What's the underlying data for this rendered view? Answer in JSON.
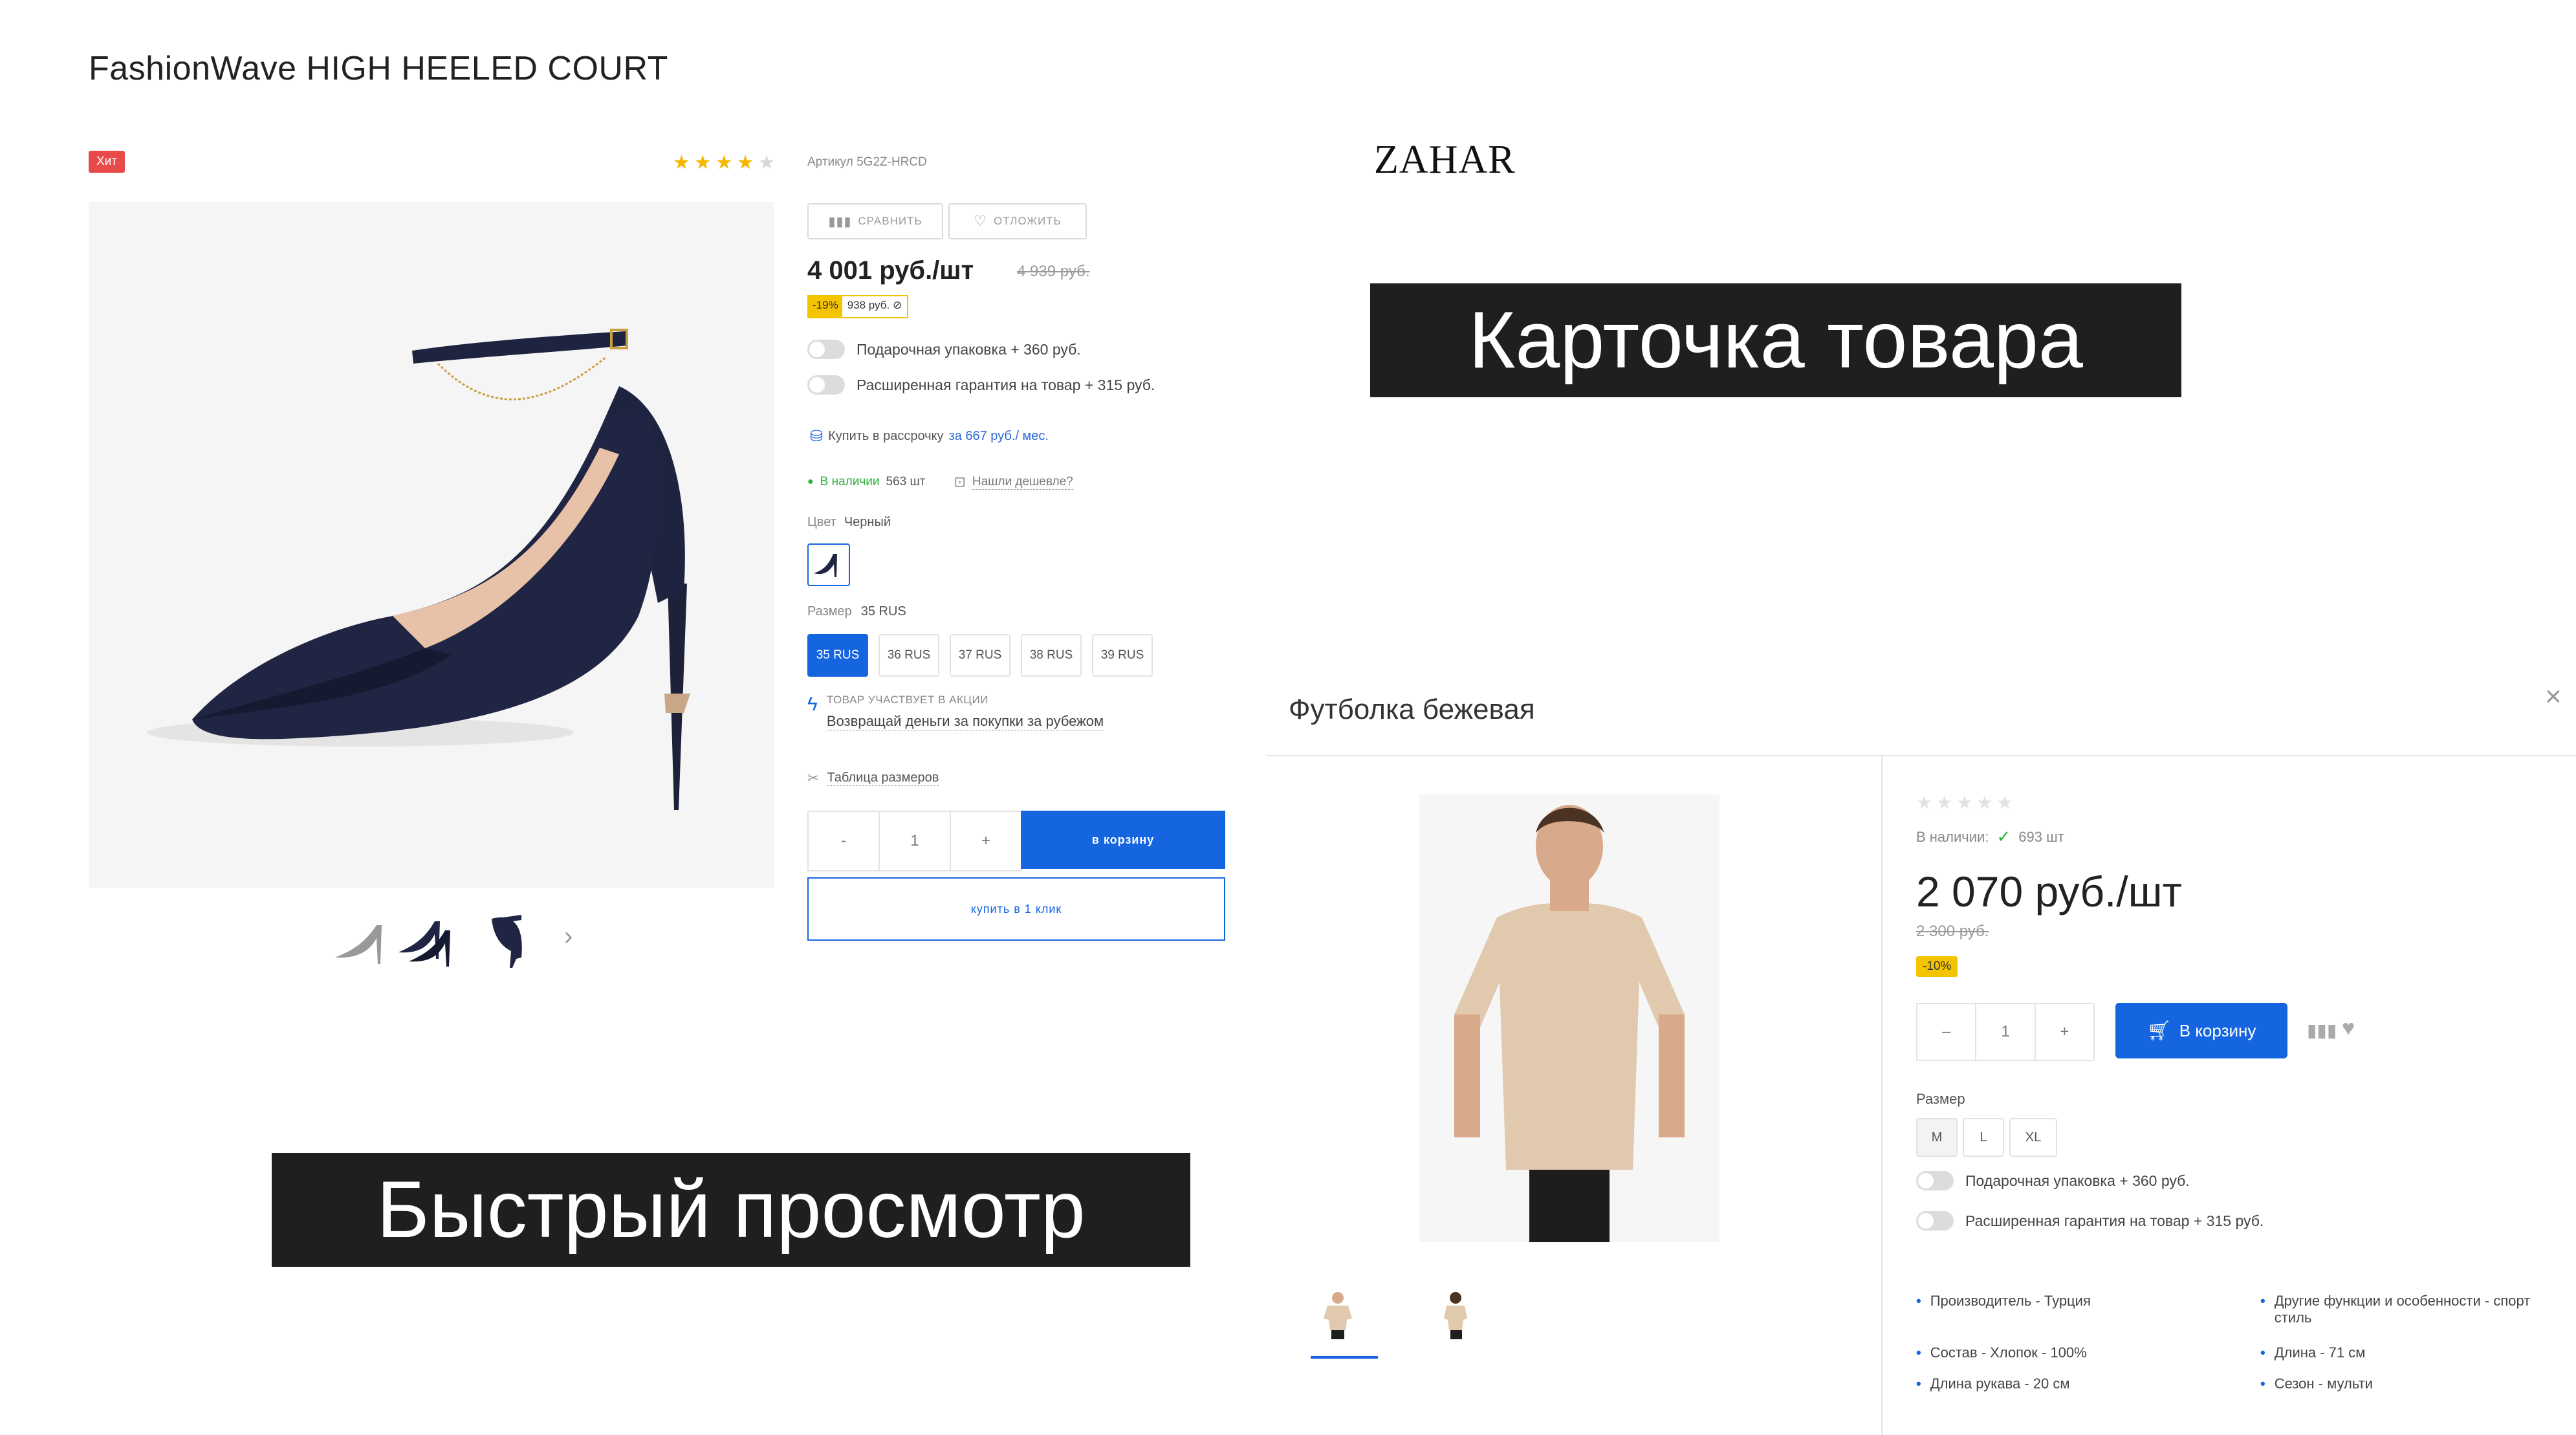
{
  "left": {
    "page_title": "FashionWave HIGH HEELED COURT",
    "badge": "Хит",
    "rating": 4,
    "sku": "Артикул 5G2Z-HRCD",
    "compare_label": "сравнить",
    "defer_label": "отложить",
    "price": "4 001 руб./шт",
    "price_old": "4 939 руб.",
    "discount_percent": "-19%",
    "discount_sum": "938 руб.",
    "options": [
      {
        "label": "Подарочная упаковка + 360 руб."
      },
      {
        "label": "Расширенная гарантия на товар + 315 руб."
      }
    ],
    "installment_text": "Купить в рассрочку",
    "installment_link": "за 667 руб./ мес.",
    "stock_label": "В наличии",
    "stock_count": "563 шт",
    "cheaper_label": "Нашли дешевле?",
    "color_label": "Цвет",
    "color_value": "Черный",
    "size_label": "Размер",
    "size_value": "35 RUS",
    "sizes": [
      "35 RUS",
      "36 RUS",
      "37 RUS",
      "38 RUS",
      "39 RUS"
    ],
    "promo_caption": "ТОВАР УЧАСТВУЕТ В АКЦИИ",
    "promo_link": "Возвращай деньги за покупки за рубежом",
    "size_table_link": "Таблица размеров",
    "qty_minus": "-",
    "qty_value": "1",
    "qty_plus": "+",
    "cart_button": "в корзину",
    "one_click_button": "купить в 1 клик"
  },
  "brand_logo": "ZAHAR",
  "banner_card": "Карточка товара",
  "banner_quick": "Быстрый просмотр",
  "quick_view": {
    "title": "Футболка бежевая",
    "close_icon": "×",
    "stock_label": "В наличии:",
    "stock_count": "693 шт",
    "price": "2 070 руб./шт",
    "price_old": "2 300 руб.",
    "discount": "-10%",
    "qty_minus": "–",
    "qty_value": "1",
    "qty_plus": "+",
    "cart_button": "В корзину",
    "size_label": "Размер",
    "sizes": [
      "M",
      "L",
      "XL"
    ],
    "options": [
      {
        "label": "Подарочная упаковка + 360 руб."
      },
      {
        "label": "Расширенная гарантия на товар + 315 руб."
      }
    ],
    "properties": [
      {
        "text": "Производитель - Турция"
      },
      {
        "text": "Другие функции и особенности - спорт стиль"
      },
      {
        "text": "Состав - Хлопок - 100%"
      },
      {
        "text": "Длина - 71 см"
      },
      {
        "text": "Длина рукава - 20 см"
      },
      {
        "text": "Сезон - мульти"
      }
    ]
  }
}
